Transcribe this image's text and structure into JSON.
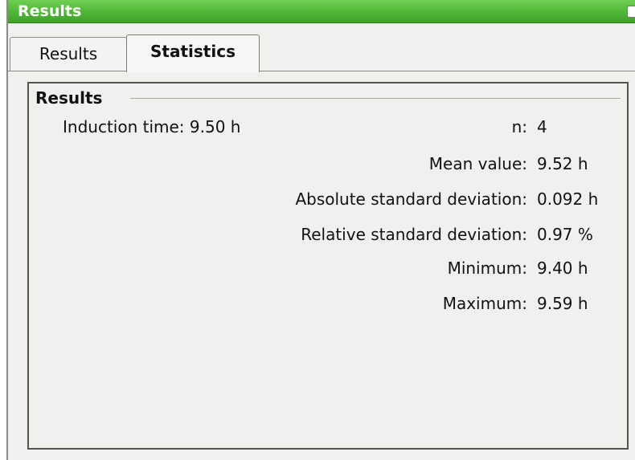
{
  "window": {
    "title": "Results"
  },
  "tabs": [
    {
      "label": "Results",
      "active": false
    },
    {
      "label": "Statistics",
      "active": true
    }
  ],
  "group": {
    "title": "Results",
    "induction_label": "Induction time:",
    "induction_value": "9.50 h",
    "stats": [
      {
        "label": "n:",
        "value": "4"
      },
      {
        "label": "Mean value:",
        "value": "9.52 h"
      },
      {
        "label": "Absolute standard deviation:",
        "value": "0.092 h"
      },
      {
        "label": "Relative standard deviation:",
        "value": "0.97 %"
      },
      {
        "label": "Minimum:",
        "value": "9.40 h"
      },
      {
        "label": "Maximum:",
        "value": "9.59 h"
      }
    ]
  },
  "colors": {
    "titlebar": "#4fb536",
    "accent": "#3fa12a"
  }
}
